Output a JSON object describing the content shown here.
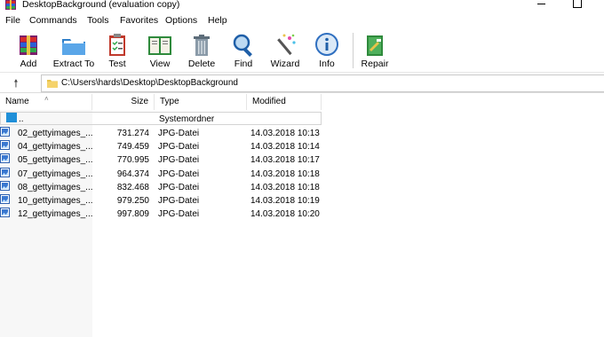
{
  "window": {
    "title": "DesktopBackground (evaluation copy)"
  },
  "menu": {
    "items": [
      "File",
      "Commands",
      "Tools",
      "Favorites",
      "Options",
      "Help"
    ]
  },
  "toolbar": {
    "buttons": [
      {
        "label": "Add",
        "icon": "add-archive-icon"
      },
      {
        "label": "Extract To",
        "icon": "extract-folder-icon"
      },
      {
        "label": "Test",
        "icon": "test-clipboard-icon"
      },
      {
        "label": "View",
        "icon": "view-book-icon"
      },
      {
        "label": "Delete",
        "icon": "trash-icon"
      },
      {
        "label": "Find",
        "icon": "magnifier-icon"
      },
      {
        "label": "Wizard",
        "icon": "wand-icon"
      },
      {
        "label": "Info",
        "icon": "info-icon"
      },
      {
        "label": "Repair",
        "icon": "repair-icon"
      }
    ]
  },
  "address": {
    "path": "C:\\Users\\hards\\Desktop\\DesktopBackground"
  },
  "columns": {
    "name": "Name",
    "size": "Size",
    "type": "Type",
    "modified": "Modified"
  },
  "up_row": {
    "name": "..",
    "type": "Systemordner"
  },
  "files": [
    {
      "name": "02_gettyimages_...",
      "size": "731.274",
      "type": "JPG-Datei",
      "modified": "14.03.2018 10:13"
    },
    {
      "name": "04_gettyimages_...",
      "size": "749.459",
      "type": "JPG-Datei",
      "modified": "14.03.2018 10:14"
    },
    {
      "name": "05_gettyimages_...",
      "size": "770.995",
      "type": "JPG-Datei",
      "modified": "14.03.2018 10:17"
    },
    {
      "name": "07_gettyimages_...",
      "size": "964.374",
      "type": "JPG-Datei",
      "modified": "14.03.2018 10:18"
    },
    {
      "name": "08_gettyimages_...",
      "size": "832.468",
      "type": "JPG-Datei",
      "modified": "14.03.2018 10:18"
    },
    {
      "name": "10_gettyimages_...",
      "size": "979.250",
      "type": "JPG-Datei",
      "modified": "14.03.2018 10:19"
    },
    {
      "name": "12_gettyimages_...",
      "size": "997.809",
      "type": "JPG-Datei",
      "modified": "14.03.2018 10:20"
    }
  ]
}
